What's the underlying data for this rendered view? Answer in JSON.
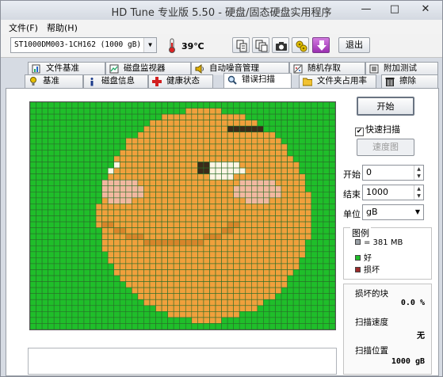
{
  "window": {
    "title": "HD Tune 专业版 5.50 - 硬盘/固态硬盘实用程序",
    "minimize": "—",
    "maximize": "□",
    "close": "✕"
  },
  "menu": [
    {
      "label": "文件(F)"
    },
    {
      "label": "帮助(H)"
    }
  ],
  "toolbar": {
    "drive": "ST1000DM003-1CH162 (1000 gB)",
    "temperature": "39℃",
    "exit_label": "退出"
  },
  "tabs_row1": [
    {
      "label": "文件基准",
      "icon": "file-benchmark-icon"
    },
    {
      "label": "磁盘监视器",
      "icon": "disk-monitor-icon"
    },
    {
      "label": "自动噪音管理",
      "icon": "speaker-icon"
    },
    {
      "label": "随机存取",
      "icon": "random-access-icon"
    },
    {
      "label": "附加测试",
      "icon": "extra-tests-icon"
    }
  ],
  "tabs_row2": [
    {
      "label": "基准",
      "icon": "benchmark-icon"
    },
    {
      "label": "磁盘信息",
      "icon": "info-icon"
    },
    {
      "label": "健康状态",
      "icon": "health-icon"
    },
    {
      "label": "错误扫描",
      "icon": "magnifier-icon"
    },
    {
      "label": "文件夹占用率",
      "icon": "folder-icon"
    },
    {
      "label": "擦除",
      "icon": "erase-icon"
    }
  ],
  "active_tab": "错误扫描",
  "scan": {
    "start_label": "开始",
    "quick_scan_label": "快速扫描",
    "quick_scan_checked": true,
    "speed_map_label": "速度图",
    "start_field_label": "开始",
    "start_value": "0",
    "end_field_label": "结束",
    "end_value": "1000",
    "unit_label": "单位",
    "unit_value": "gB",
    "legend_title": "图例",
    "legend_block": "= 381 MB",
    "legend_good": "好",
    "legend_bad": "损坏",
    "damaged_blocks_label": "损坏的块",
    "damaged_blocks_value": "0.0 %",
    "scan_speed_label": "扫描速度",
    "scan_speed_value": "无",
    "scan_position_label": "扫描位置",
    "scan_position_value": "1000 gB"
  },
  "colors": {
    "good": "#1fbe2a",
    "bad": "#9c2a2a",
    "grid_line": "#2a6e2a",
    "face": "#f0a03c",
    "face_dark": "#d8852a",
    "cheek": "#f2b8a0",
    "eye_white": "#fff6e6",
    "brow": "#3a2a1a"
  },
  "grid": {
    "cols": 51,
    "rows": 38
  }
}
